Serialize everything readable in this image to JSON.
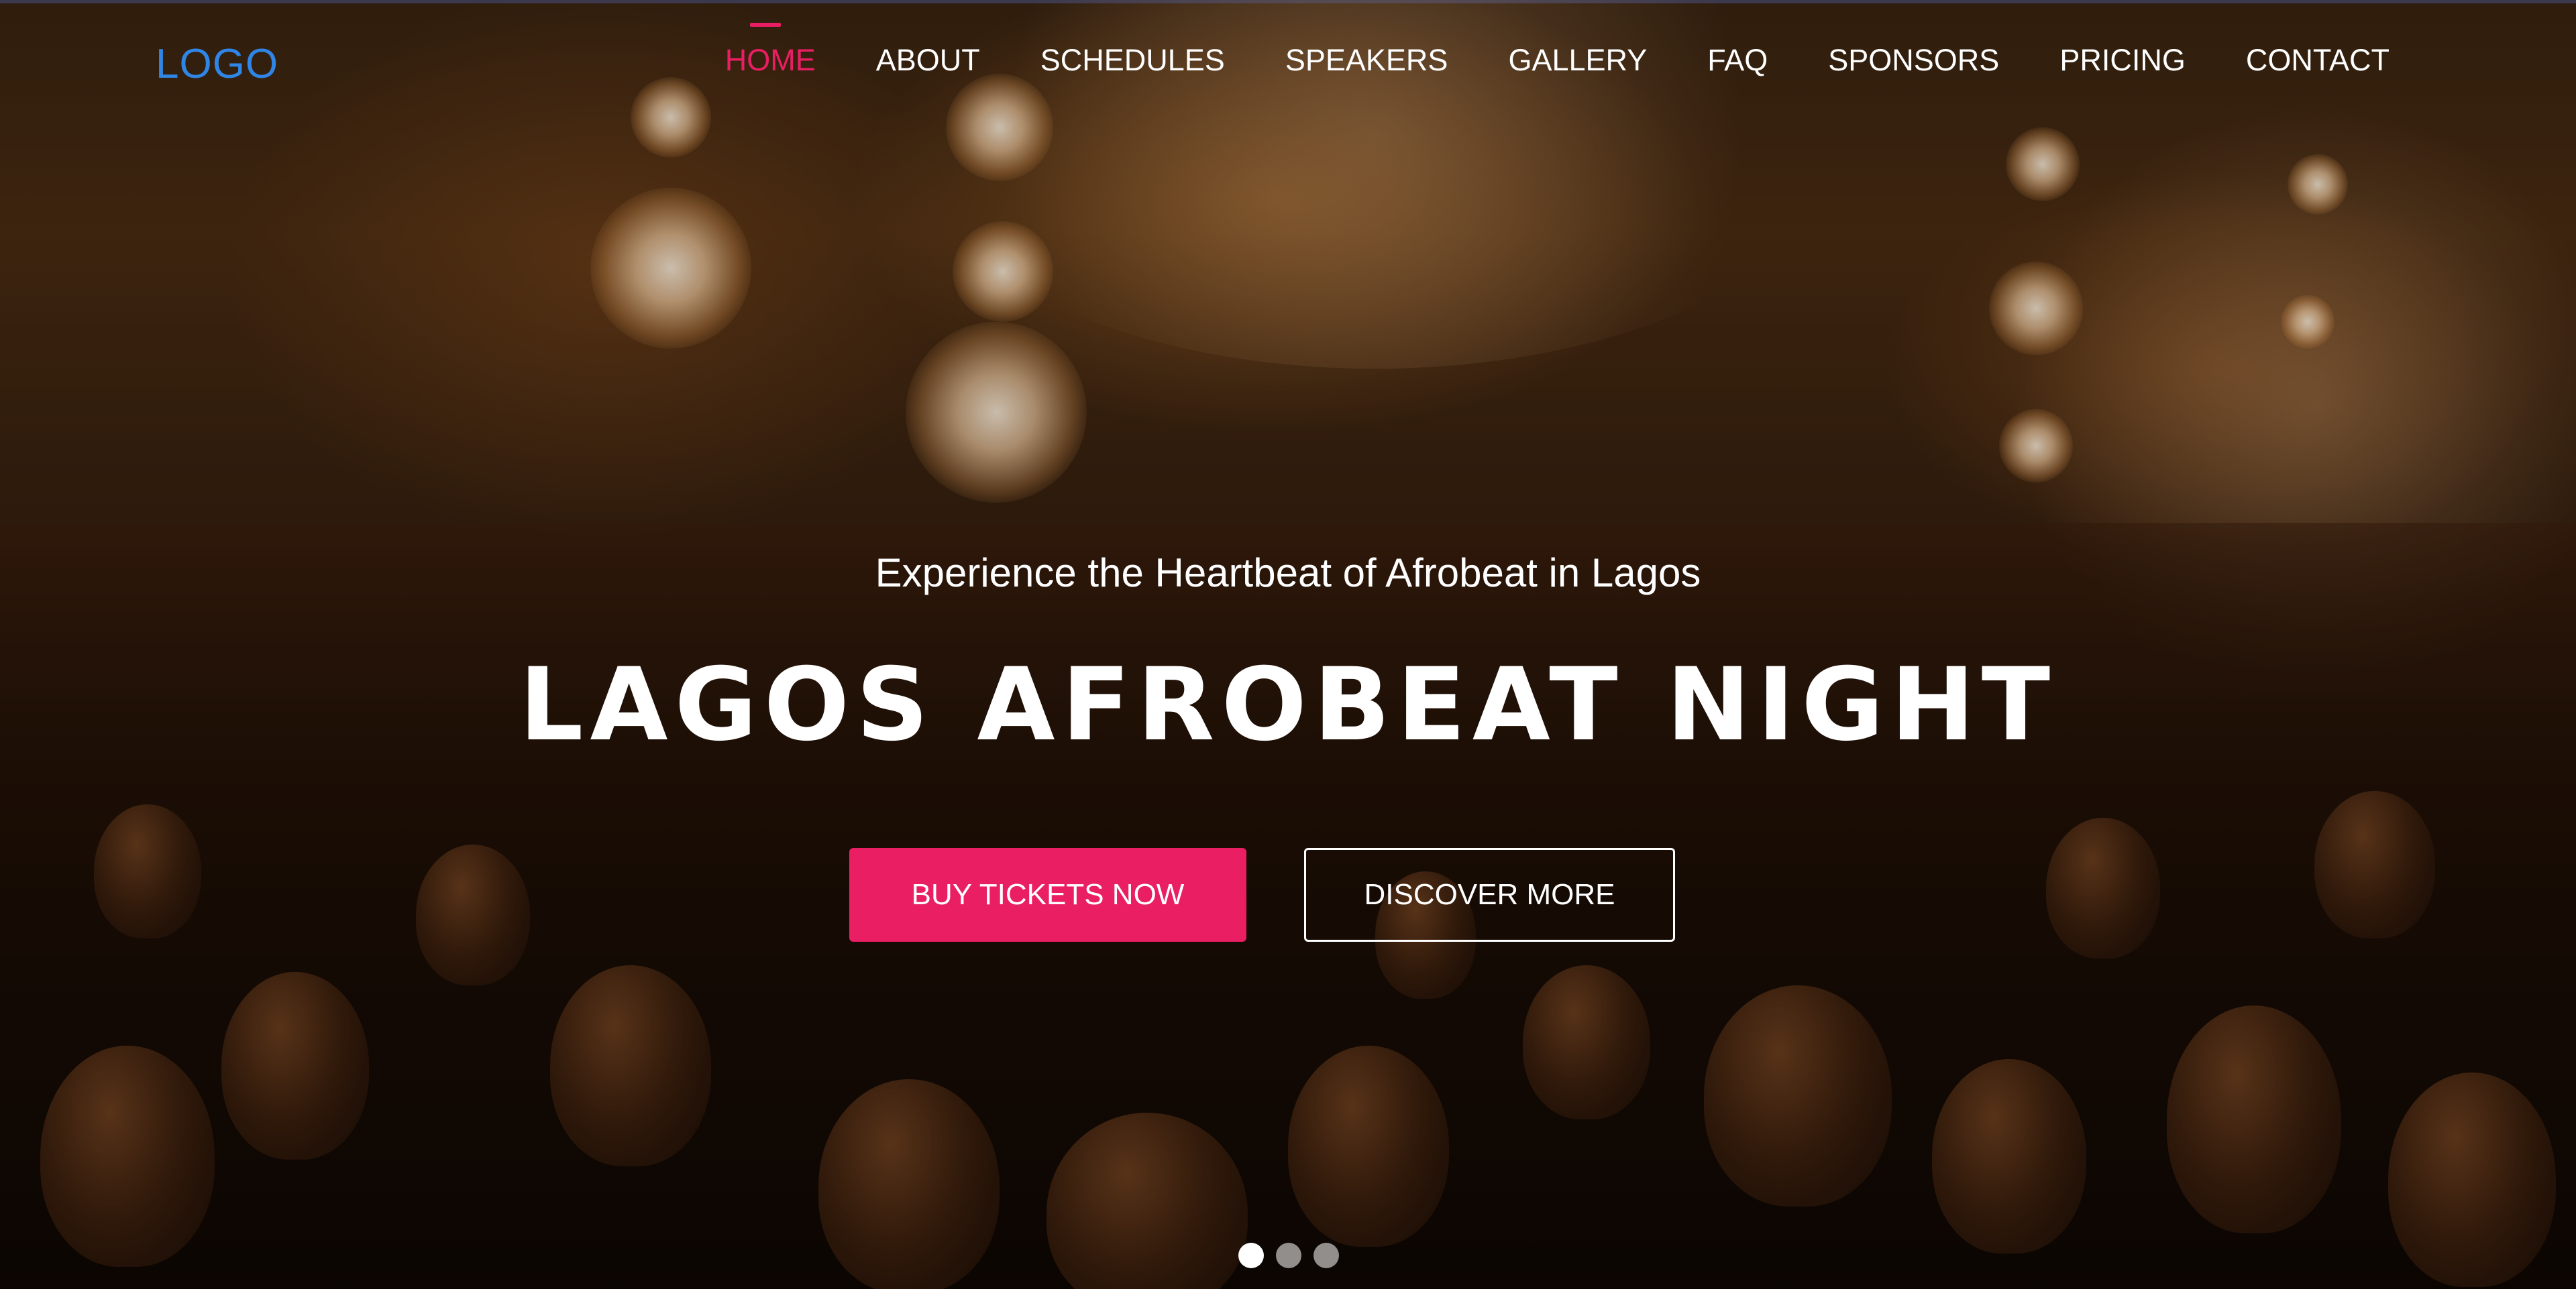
{
  "brand": {
    "logo_text": "LOGO",
    "logo_color": "#2f86e6"
  },
  "nav": {
    "items": [
      {
        "label": "HOME",
        "active": true
      },
      {
        "label": "ABOUT",
        "active": false
      },
      {
        "label": "SCHEDULES",
        "active": false
      },
      {
        "label": "SPEAKERS",
        "active": false
      },
      {
        "label": "GALLERY",
        "active": false
      },
      {
        "label": "FAQ",
        "active": false
      },
      {
        "label": "SPONSORS",
        "active": false
      },
      {
        "label": "PRICING",
        "active": false
      },
      {
        "label": "CONTACT",
        "active": false
      }
    ],
    "active_color": "#e91e63"
  },
  "hero": {
    "subtitle": "Experience the Heartbeat of Afrobeat in Lagos",
    "headline": "LAGOS AFROBEAT NIGHT",
    "primary_button": "BUY TICKETS NOW",
    "secondary_button": "DISCOVER MORE",
    "accent_color": "#e91e63",
    "background_image": "concert-crowd-stage-lights"
  },
  "carousel": {
    "slide_count": 3,
    "active_index": 0
  }
}
